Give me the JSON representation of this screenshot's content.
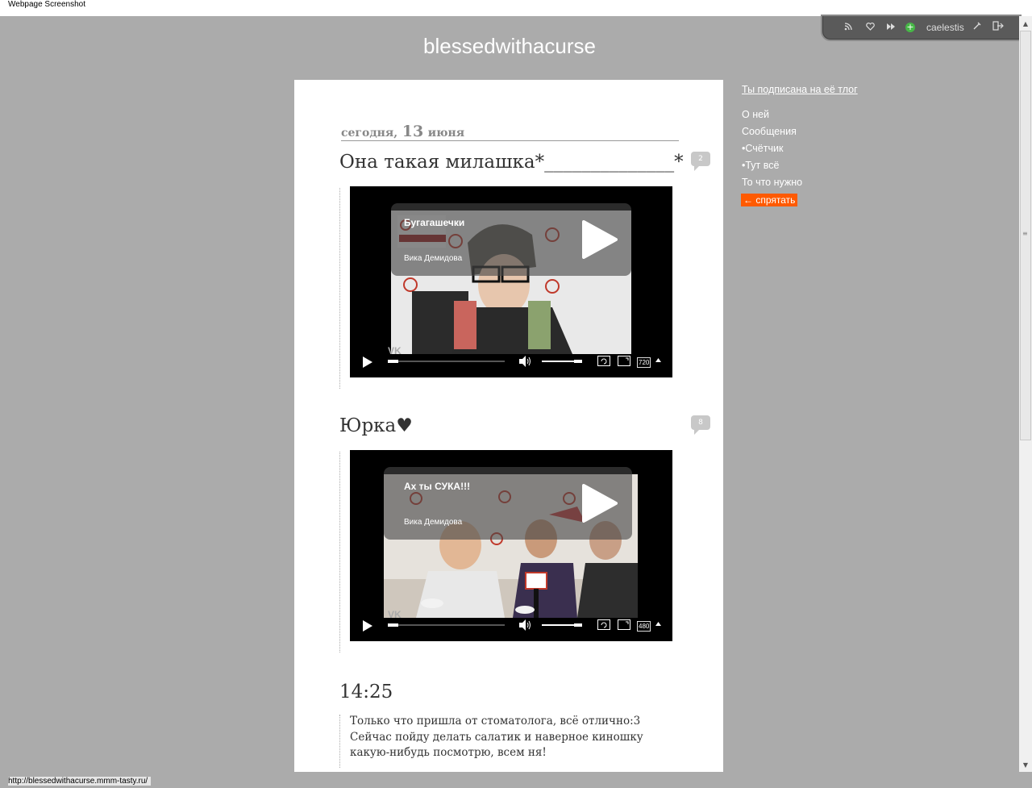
{
  "window": {
    "caption": "Webpage Screenshot"
  },
  "blog": {
    "title": "blessedwithacurse"
  },
  "toolbar": {
    "username": "caelestis"
  },
  "date_header": {
    "prefix": "сегодня,",
    "day": "13",
    "month": "июня"
  },
  "posts": [
    {
      "title": "Она такая милашка*______________*",
      "comments": "2",
      "video": {
        "title": "Бугагашечки",
        "author": "Вика Демидова",
        "quality": "720",
        "logo": "VK"
      }
    },
    {
      "title": "Юрка♥",
      "comments": "8",
      "video": {
        "title": "Ах ты СУКА!!!",
        "author": "Вика Демидова",
        "quality": "480",
        "logo": "VK"
      }
    },
    {
      "title": "14:25",
      "text": "Только что пришла от стоматолога, всё отлично:3 Сейчас пойду делать салатик и наверное киношку какую-нибудь посмотрю, всем ня!"
    }
  ],
  "sidebar": {
    "subscription": "Ты подписана на её тлог",
    "links": [
      "О ней",
      "Сообщения",
      "•Счётчик",
      "•Тут всё",
      "То что нужно"
    ],
    "hide": "← спрятать"
  },
  "status_url": "http://blessedwithacurse.mmm-tasty.ru/",
  "colors": {
    "accent": "#ff5a00",
    "background": "#ababab"
  }
}
